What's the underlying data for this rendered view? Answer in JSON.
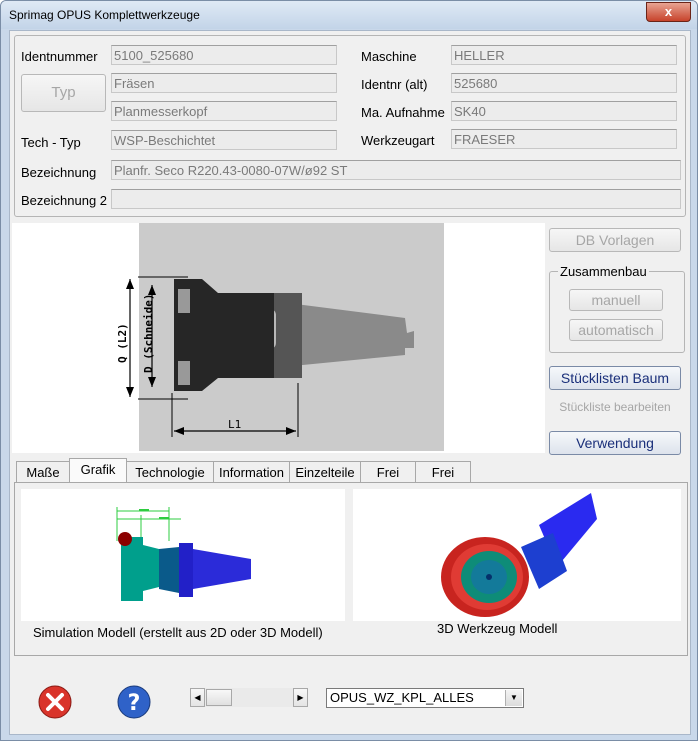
{
  "window": {
    "title": "Sprimag OPUS Komplettwerkzeuge",
    "close_glyph": "x"
  },
  "fields": {
    "identnummer_label": "Identnummer",
    "identnummer": "5100_525680",
    "typ_button": "Typ",
    "typ_line1": "Fräsen",
    "typ_line2": "Planmesserkopf",
    "techtyp_label": "Tech - Typ",
    "techtyp": "WSP-Beschichtet",
    "maschine_label": "Maschine",
    "maschine": "HELLER",
    "identnr_alt_label": "Identnr (alt)",
    "identnr_alt": "525680",
    "aufnahme_label": "Ma. Aufnahme",
    "aufnahme": "SK40",
    "werkzeugart_label": "Werkzeugart",
    "werkzeugart": "FRAESER",
    "bezeichnung_label": "Bezeichnung",
    "bezeichnung": "Planfr. Seco R220.43-0080-07W/ø92 ST",
    "bezeichnung2_label": "Bezeichnung 2",
    "bezeichnung2": ""
  },
  "photo": {
    "dim_q": "Q (L2)",
    "dim_d": "D (Schneide)",
    "dim_l1": "L1"
  },
  "buttons": {
    "db_vorlagen": "DB Vorlagen",
    "zusammenbau": "Zusammenbau",
    "manuell": "manuell",
    "automatisch": "automatisch",
    "stuecklisten_baum": "Stücklisten Baum",
    "stueckliste_bearbeiten": "Stückliste bearbeiten",
    "verwendung": "Verwendung"
  },
  "tabs": [
    "Maße",
    "Grafik",
    "Technologie",
    "Information",
    "Einzelteile",
    "Frei",
    "Frei"
  ],
  "selected_tab": "Grafik",
  "grafik": {
    "caption_sim": "Simulation Modell (erstellt aus 2D oder 3D Modell)",
    "caption_3d": "3D Werkzeug Modell"
  },
  "footer": {
    "combo_value": "OPUS_WZ_KPL_ALLES",
    "close_icon": "red-x-icon",
    "help_icon": "question-mark-icon",
    "scroll_left": "◀",
    "scroll_right": "▶",
    "combo_arrow": "▼",
    "help_glyph": "?"
  },
  "colors": {
    "accent_text": "#1a2f7a",
    "close_red": "#d9342b",
    "help_blue": "#2f62c8"
  }
}
